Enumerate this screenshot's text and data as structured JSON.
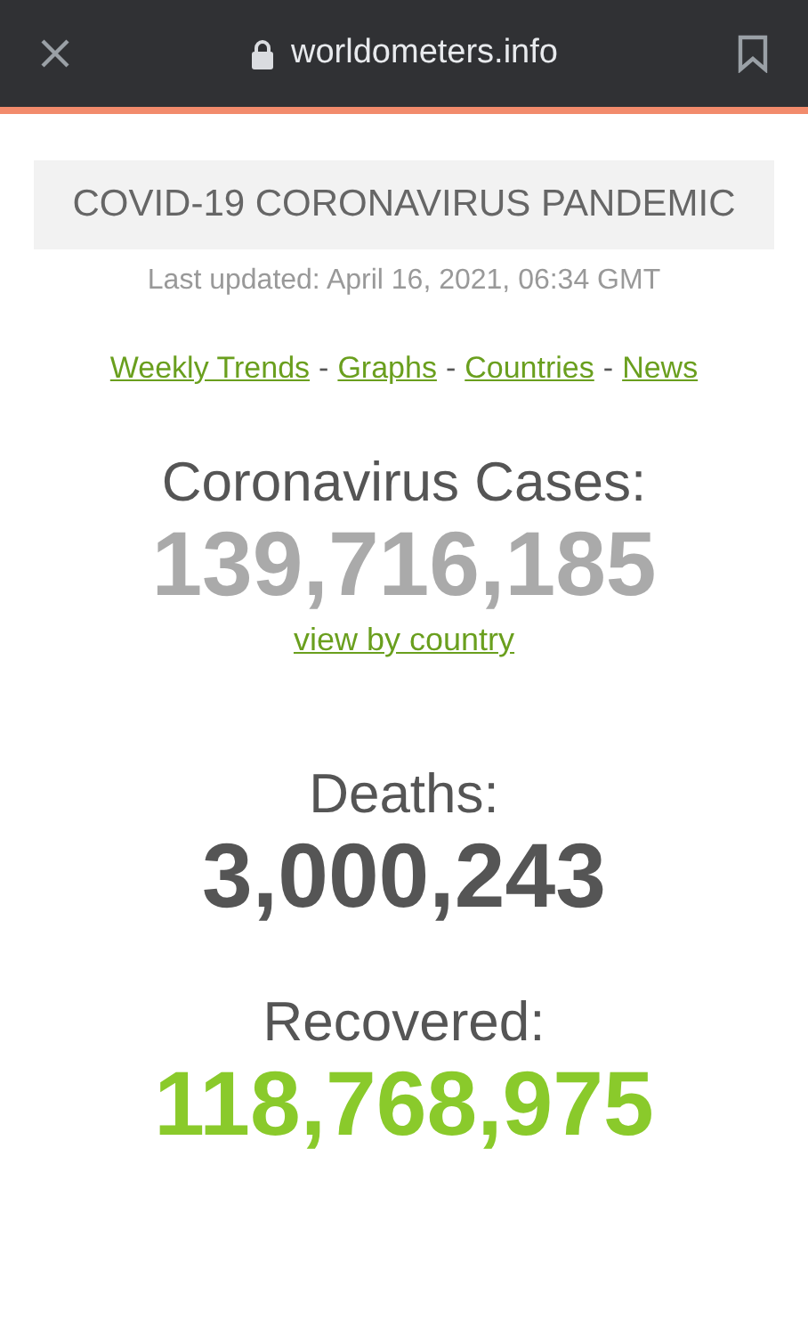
{
  "browser_bar": {
    "url": "worldometers.info"
  },
  "banner": {
    "title": "COVID-19 CORONAVIRUS PANDEMIC",
    "updated": "Last updated: April 16, 2021, 06:34 GMT"
  },
  "nav": [
    {
      "kind": "link",
      "text": "Weekly Trends"
    },
    {
      "kind": "separator",
      "text": "-"
    },
    {
      "kind": "link",
      "text": "Graphs"
    },
    {
      "kind": "separator",
      "text": "-"
    },
    {
      "kind": "link",
      "text": "Countries"
    },
    {
      "kind": "separator",
      "text": "-"
    },
    {
      "kind": "link",
      "text": "News"
    }
  ],
  "counters": [
    {
      "label": "Coronavirus Cases:",
      "value": "139,716,185",
      "color": "#aaaaaa",
      "link": "view by country"
    },
    {
      "label": "Deaths:",
      "value": "3,000,243",
      "color": "#555555"
    },
    {
      "label": "Recovered:",
      "value": "118,768,975",
      "color": "#8aca2b"
    }
  ]
}
